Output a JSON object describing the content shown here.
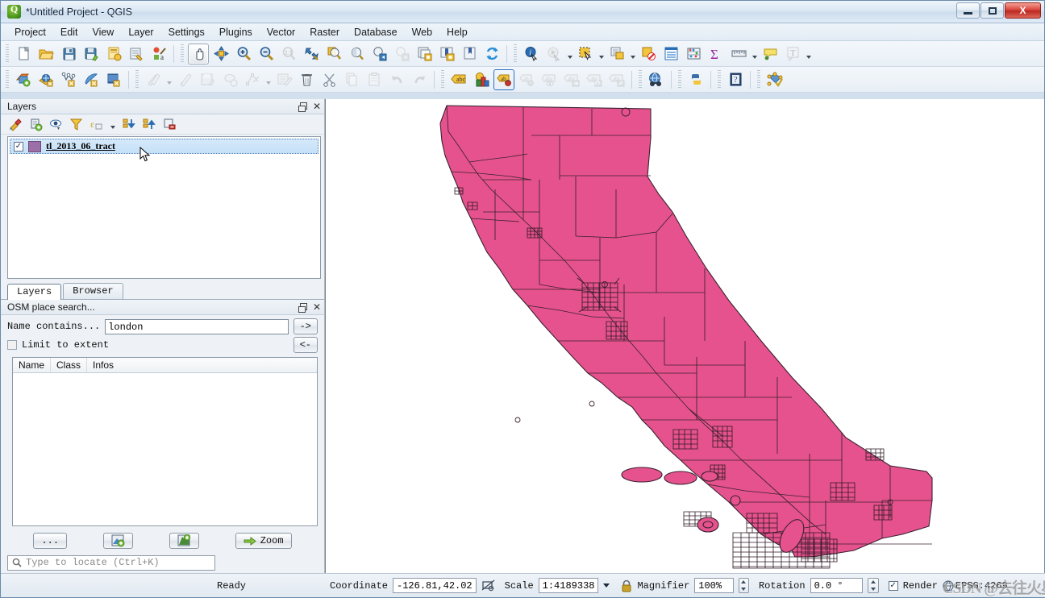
{
  "window": {
    "title": "*Untitled Project - QGIS",
    "ghost_title": "",
    "minimize": "minimize-button",
    "maximize": "maximize-button",
    "close": "X"
  },
  "menubar": {
    "items": [
      {
        "label": "Project"
      },
      {
        "label": "Edit"
      },
      {
        "label": "View"
      },
      {
        "label": "Layer"
      },
      {
        "label": "Settings"
      },
      {
        "label": "Plugins"
      },
      {
        "label": "Vector"
      },
      {
        "label": "Raster"
      },
      {
        "label": "Database"
      },
      {
        "label": "Web"
      },
      {
        "label": "Help"
      }
    ]
  },
  "toolbar_top": {
    "buttons": [
      {
        "name": "new-project-icon",
        "tip": "New Project"
      },
      {
        "name": "open-project-icon",
        "tip": "Open Project"
      },
      {
        "name": "save-project-icon",
        "tip": "Save Project"
      },
      {
        "name": "save-project-as-icon",
        "tip": "Save Project As"
      },
      {
        "name": "new-print-layout-icon",
        "tip": "New Print Layout"
      },
      {
        "name": "layout-manager-icon",
        "tip": "Layout Manager"
      },
      {
        "name": "style-manager-icon",
        "tip": "Style Manager"
      },
      {
        "name": "pan-map-icon",
        "tip": "Pan Map"
      },
      {
        "name": "pan-to-selection-icon",
        "tip": "Pan Map to Selection"
      },
      {
        "name": "zoom-in-icon",
        "tip": "Zoom In"
      },
      {
        "name": "zoom-out-icon",
        "tip": "Zoom Out"
      },
      {
        "name": "zoom-native-icon",
        "tip": "Zoom to Native Resolution"
      },
      {
        "name": "zoom-full-icon",
        "tip": "Zoom Full"
      },
      {
        "name": "zoom-selection-icon",
        "tip": "Zoom to Selection"
      },
      {
        "name": "zoom-layer-icon",
        "tip": "Zoom to Layer"
      },
      {
        "name": "zoom-last-icon",
        "tip": "Zoom Last"
      },
      {
        "name": "zoom-next-icon",
        "tip": "Zoom Next"
      },
      {
        "name": "new-map-view-icon",
        "tip": "New Map View"
      },
      {
        "name": "new-3d-map-view-icon",
        "tip": "New 3D Map View"
      },
      {
        "name": "show-bookmarks-icon",
        "tip": "Show Bookmarks"
      },
      {
        "name": "refresh-icon",
        "tip": "Refresh"
      },
      {
        "name": "identify-features-icon",
        "tip": "Identify Features"
      },
      {
        "name": "run-feature-action-icon",
        "tip": "Run Feature Action"
      },
      {
        "name": "select-features-icon",
        "tip": "Select Features by Area"
      },
      {
        "name": "select-by-value-icon",
        "tip": "Select Features by Value"
      },
      {
        "name": "deselect-features-icon",
        "tip": "Deselect Features"
      },
      {
        "name": "open-attribute-table-icon",
        "tip": "Open Attribute Table"
      },
      {
        "name": "field-calculator-icon",
        "tip": "Field Calculator"
      },
      {
        "name": "statistical-summary-icon",
        "tip": "Statistical Summary"
      },
      {
        "name": "measure-line-icon",
        "tip": "Measure Line"
      },
      {
        "name": "map-tips-icon",
        "tip": "Show Map Tips"
      },
      {
        "name": "new-text-annotation-icon",
        "tip": "Text Annotation"
      }
    ]
  },
  "toolbar_second": {
    "buttons": [
      {
        "name": "add-vector-layer-icon",
        "tip": "Add Vector Layer"
      },
      {
        "name": "add-raster-layer-icon",
        "tip": "Add Raster Layer"
      },
      {
        "name": "add-delimited-text-layer-icon",
        "tip": "Add Delimited Text Layer"
      },
      {
        "name": "add-postgis-layer-icon",
        "tip": "Add PostGIS Layer"
      },
      {
        "name": "add-spatialite-layer-icon",
        "tip": "Add SpatiaLite Layer"
      },
      {
        "name": "current-edits-icon",
        "tip": "Current Edits"
      },
      {
        "name": "toggle-editing-icon",
        "tip": "Toggle Editing"
      },
      {
        "name": "save-layer-edits-icon",
        "tip": "Save Layer Edits"
      },
      {
        "name": "add-feature-icon",
        "tip": "Add Feature"
      },
      {
        "name": "vertex-tool-icon",
        "tip": "Vertex Tool"
      },
      {
        "name": "modify-attributes-icon",
        "tip": "Modify Attributes of Features"
      },
      {
        "name": "delete-selected-icon",
        "tip": "Delete Selected"
      },
      {
        "name": "cut-features-icon",
        "tip": "Cut Features"
      },
      {
        "name": "copy-features-icon",
        "tip": "Copy Features"
      },
      {
        "name": "paste-features-icon",
        "tip": "Paste Features"
      },
      {
        "name": "undo-icon",
        "tip": "Undo"
      },
      {
        "name": "redo-icon",
        "tip": "Redo"
      },
      {
        "name": "label-layer-icon",
        "tip": "Layer Labeling Options"
      },
      {
        "name": "layer-styling-icon",
        "tip": "Layer Styling"
      },
      {
        "name": "pin-labels-icon",
        "tip": "Pin/Unpin Labels"
      },
      {
        "name": "highlight-pinned-labels-icon",
        "tip": "Highlight Pinned Labels"
      },
      {
        "name": "show-hide-labels-icon",
        "tip": "Show/Hide Labels"
      },
      {
        "name": "move-label-icon",
        "tip": "Move Label"
      },
      {
        "name": "rotate-label-icon",
        "tip": "Rotate Label"
      },
      {
        "name": "change-label-icon",
        "tip": "Change Label"
      },
      {
        "name": "metasearch-icon",
        "tip": "MetaSearch"
      },
      {
        "name": "python-console-icon",
        "tip": "Python Console"
      },
      {
        "name": "help-contents-icon",
        "tip": "Help Contents"
      },
      {
        "name": "osm-place-search-icon",
        "tip": "OSM Place Search"
      }
    ]
  },
  "layers_panel": {
    "title": "Layers",
    "toolbar": [
      {
        "name": "open-layer-styling-panel-icon"
      },
      {
        "name": "add-group-icon"
      },
      {
        "name": "manage-layer-visibility-icon"
      },
      {
        "name": "filter-legend-icon"
      },
      {
        "name": "filter-legend-expression-icon"
      },
      {
        "name": "expand-all-icon"
      },
      {
        "name": "collapse-all-icon"
      },
      {
        "name": "remove-layer-icon"
      }
    ],
    "layer": {
      "name": "tl_2013_06_tract",
      "checked": true,
      "symbol_color": "#9b6fa8"
    }
  },
  "panel_tabs": [
    {
      "label": "Layers",
      "selected": true
    },
    {
      "label": "Browser",
      "selected": false
    }
  ],
  "osm_panel": {
    "title": "OSM place search...",
    "name_contains_label": "Name contains...",
    "search_value": "london",
    "search_placeholder": "",
    "go_button": "->",
    "back_button": "<-",
    "limit_to_extent_label": "Limit to extent",
    "limit_to_extent_checked": false,
    "table_headers": [
      "Name",
      "Class",
      "Infos"
    ],
    "table_rows": [],
    "buttons": [
      {
        "name": "more-options-button",
        "label": "..."
      },
      {
        "name": "save-results-button",
        "label": ""
      },
      {
        "name": "add-to-map-button",
        "label": ""
      },
      {
        "name": "zoom-button",
        "label": "Zoom"
      }
    ]
  },
  "locator": {
    "placeholder": "Type to locate (Ctrl+K)",
    "value": ""
  },
  "statusbar": {
    "ready_text": "Ready",
    "coordinate_label": "Coordinate",
    "coordinate_value": "-126.81,42.02",
    "scale_label": "Scale",
    "scale_value": "1:4189338",
    "magnifier_label": "Magnifier",
    "magnifier_value": "100%",
    "rotation_label": "Rotation",
    "rotation_value": "0.0 °",
    "render_label": "Render",
    "render_checked": true,
    "epsg_text": "EPSG:4269",
    "watermark_text": "CSDN @去往火星"
  },
  "map": {
    "fill_color": "#e6528d",
    "stroke_color": "#3a2230",
    "background": "#ffffff",
    "layer_title": "tl_2013_06_tract"
  }
}
